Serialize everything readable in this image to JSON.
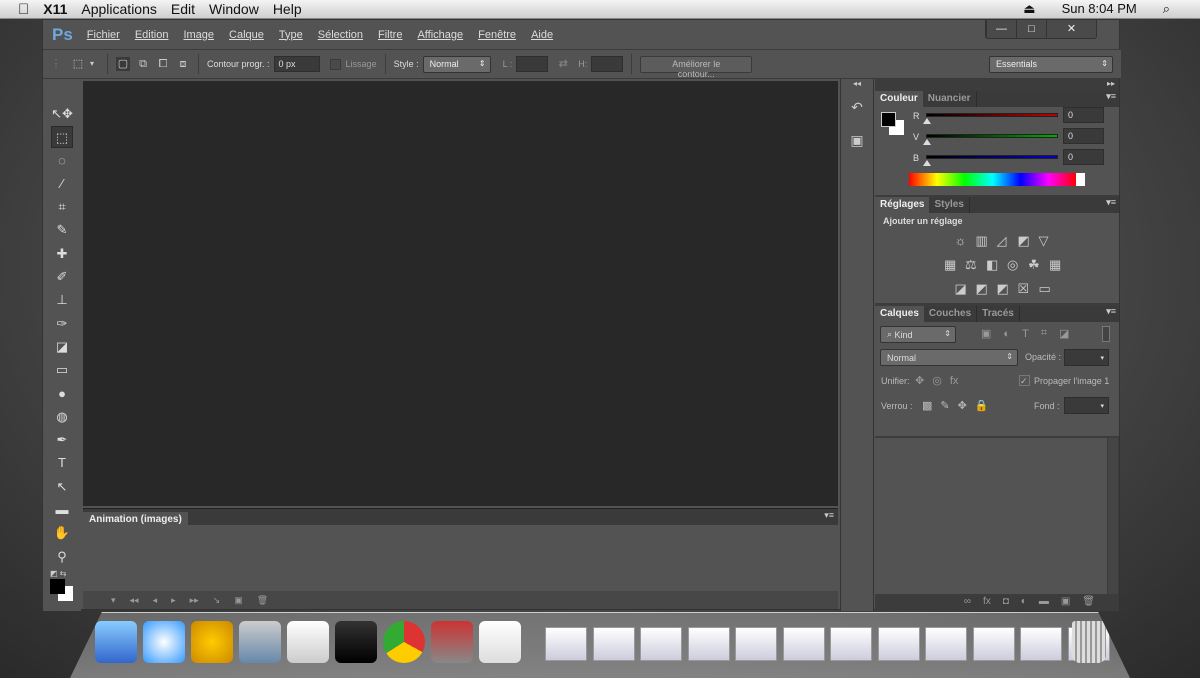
{
  "macbar": {
    "apple": "",
    "items": [
      "X11",
      "Applications",
      "Edit",
      "Window",
      "Help"
    ],
    "clock": "Sun 8:04 PM",
    "eject": "⏏",
    "search": "⌕"
  },
  "ps": {
    "logo": "Ps",
    "menu": [
      "Fichier",
      "Edition",
      "Image",
      "Calque",
      "Type",
      "Sélection",
      "Filtre",
      "Affichage",
      "Fenêtre",
      "Aide"
    ],
    "window_buttons": [
      "—",
      "□",
      "✕"
    ],
    "options": {
      "contour_label": "Contour progr. :",
      "contour_value": "0 px",
      "lissage": "Lissage",
      "style_label": "Style :",
      "style_value": "Normal",
      "l_label": "L :",
      "h_label": "H:",
      "refine": "Améliorer le contour...",
      "workspace": "Essentials"
    },
    "tools": [
      "↖✥",
      "⬚",
      "◌",
      "⁄",
      "⌗",
      "✎",
      "✚",
      "✐",
      "⊥",
      "✑",
      "◪",
      "▭",
      "●",
      "◍",
      "✒",
      "T",
      "↖",
      "▬",
      "✋",
      "⚲"
    ],
    "animation": {
      "tab": "Animation (images)",
      "controls": [
        "▾",
        "◂◂",
        "◂",
        "▸",
        "▸▸",
        "↘",
        "▣",
        "🗑"
      ]
    },
    "couleur": {
      "tabs": [
        "Couleur",
        "Nuancier"
      ],
      "channels": [
        {
          "label": "R",
          "value": "0",
          "color": "#c00000"
        },
        {
          "label": "V",
          "value": "0",
          "color": "#00b000"
        },
        {
          "label": "B",
          "value": "0",
          "color": "#0000d0"
        }
      ]
    },
    "reglages": {
      "tabs": [
        "Réglages",
        "Styles"
      ],
      "title": "Ajouter un réglage",
      "icons": [
        [
          "☼",
          "▥",
          "◿",
          "◩",
          "▽"
        ],
        [
          "▦",
          "⚖",
          "◧",
          "◎",
          "☘",
          "▦"
        ],
        [
          "◪",
          "◩",
          "◩",
          "☒",
          "▭"
        ]
      ]
    },
    "calques": {
      "tabs": [
        "Calques",
        "Couches",
        "Tracés"
      ],
      "kind": "Kind",
      "blend": "Normal",
      "opacity_label": "Opacité :",
      "unifier_label": "Unifier:",
      "propagate": "Propager l'image 1",
      "verrou_label": "Verrou :",
      "fond_label": "Fond :",
      "bottom_icons": [
        "∞",
        "fx",
        "◘",
        "◐",
        "▬",
        "▣",
        "🗑"
      ]
    }
  },
  "dock": {
    "apps": [
      "Finder",
      "Safari",
      "Opera",
      "Network",
      "TextEdit",
      "Terminal",
      "Chrome",
      "Xcode Tools",
      "X11"
    ]
  }
}
